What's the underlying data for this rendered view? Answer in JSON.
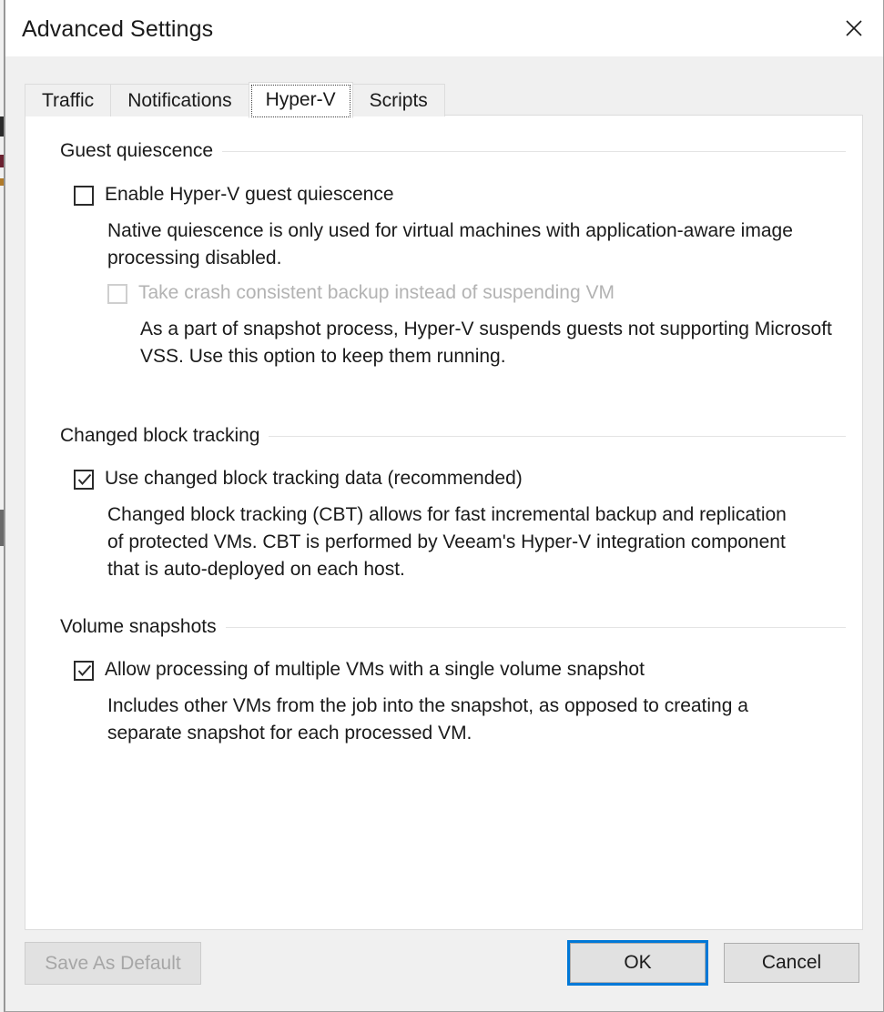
{
  "window": {
    "title": "Advanced Settings",
    "close_icon": "close-icon",
    "close_label": "Close"
  },
  "tabs": [
    {
      "label": "Traffic",
      "selected": false
    },
    {
      "label": "Notifications",
      "selected": false
    },
    {
      "label": "Hyper-V",
      "selected": true
    },
    {
      "label": "Scripts",
      "selected": false
    }
  ],
  "groups": {
    "guest_quiescence": {
      "title": "Guest quiescence",
      "enable_checkbox": {
        "label": "Enable Hyper-V guest quiescence",
        "checked": false,
        "enabled": true
      },
      "description": "Native quiescence is only used for virtual machines with application-aware image processing disabled.",
      "crash_consistent_checkbox": {
        "label": "Take crash consistent backup instead of suspending VM",
        "checked": false,
        "enabled": false
      },
      "crash_consistent_description": "As a part of snapshot process, Hyper-V suspends guests not supporting Microsoft VSS. Use this option to keep them running."
    },
    "changed_block_tracking": {
      "title": "Changed block tracking",
      "cbt_checkbox": {
        "label": "Use changed block tracking data (recommended)",
        "checked": true,
        "enabled": true
      },
      "description": "Changed block tracking (CBT) allows for fast incremental backup and replication of protected VMs. CBT is performed by Veeam's Hyper-V integration component that is auto-deployed on each host."
    },
    "volume_snapshots": {
      "title": "Volume snapshots",
      "multi_vm_checkbox": {
        "label": "Allow processing of multiple VMs with a single volume snapshot",
        "checked": true,
        "enabled": true
      },
      "description": "Includes other VMs from the job into the snapshot, as opposed to creating a separate snapshot for each processed VM."
    }
  },
  "footer": {
    "save_as_default_label": "Save As Default",
    "save_as_default_enabled": false,
    "ok_label": "OK",
    "cancel_label": "Cancel"
  },
  "colors": {
    "accent": "#0078d7",
    "dialog_bg": "#f0f0f0",
    "panel_bg": "#ffffff",
    "text": "#1a1a1a",
    "disabled_text": "#a6a6a6",
    "rule": "#e4e4e4"
  }
}
